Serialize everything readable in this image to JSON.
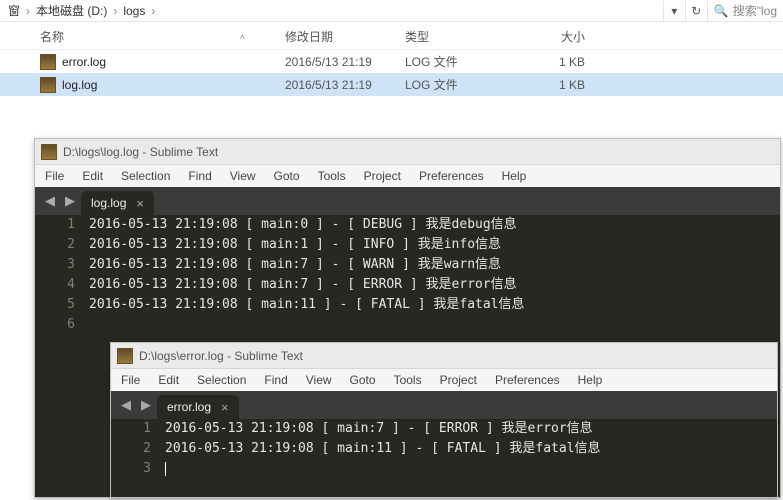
{
  "explorer": {
    "crumbs": [
      "本地磁盘 (D:)",
      "logs"
    ],
    "refresh_glyph": "↻",
    "dropdown_glyph": "▾",
    "search_placeholder": "搜索\"log",
    "columns": {
      "name": "名称",
      "date": "修改日期",
      "type": "类型",
      "size": "大小",
      "sort_caret": "˄"
    },
    "rows": [
      {
        "name": "error.log",
        "date": "2016/5/13 21:19",
        "type": "LOG 文件",
        "size": "1 KB",
        "selected": false
      },
      {
        "name": "log.log",
        "date": "2016/5/13 21:19",
        "type": "LOG 文件",
        "size": "1 KB",
        "selected": true
      }
    ]
  },
  "menus": [
    "File",
    "Edit",
    "Selection",
    "Find",
    "View",
    "Goto",
    "Tools",
    "Project",
    "Preferences",
    "Help"
  ],
  "win1": {
    "title": "D:\\logs\\log.log - Sublime Text",
    "tab": "log.log",
    "tab_close": "×",
    "lines": [
      "2016-05-13 21:19:08 [ main:0 ] - [ DEBUG ] 我是debug信息",
      "2016-05-13 21:19:08 [ main:1 ] - [ INFO ] 我是info信息",
      "2016-05-13 21:19:08 [ main:7 ] - [ WARN ] 我是warn信息",
      "2016-05-13 21:19:08 [ main:7 ] - [ ERROR ] 我是error信息",
      "2016-05-13 21:19:08 [ main:11 ] - [ FATAL ] 我是fatal信息",
      ""
    ]
  },
  "win2": {
    "title": "D:\\logs\\error.log - Sublime Text",
    "tab": "error.log",
    "tab_close": "×",
    "lines": [
      "2016-05-13 21:19:08 [ main:7 ] - [ ERROR ] 我是error信息",
      "2016-05-13 21:19:08 [ main:11 ] - [ FATAL ] 我是fatal信息",
      ""
    ]
  },
  "linenums": {
    "n1": "1",
    "n2": "2",
    "n3": "3",
    "n4": "4",
    "n5": "5",
    "n6": "6"
  },
  "nav": {
    "left": "◀",
    "right": "▶"
  }
}
